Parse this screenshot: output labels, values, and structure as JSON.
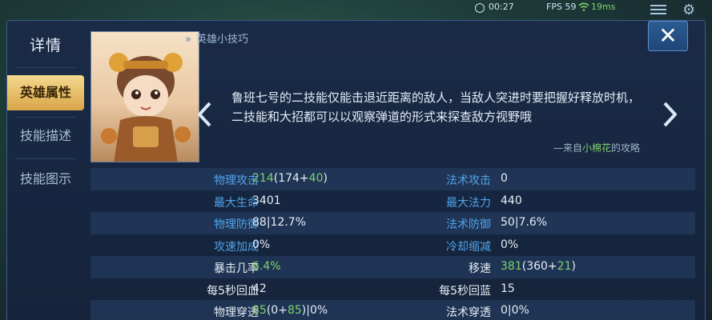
{
  "statusbar": {
    "time": "00:27",
    "fps": "FPS 59",
    "wifi_icon": "wifi-icon",
    "ping": "19ms"
  },
  "sidebar": {
    "title": "详情",
    "items": [
      {
        "label": "英雄属性",
        "active": true
      },
      {
        "label": "技能描述",
        "active": false
      },
      {
        "label": "技能图示",
        "active": false
      }
    ]
  },
  "close_icon": "close-icon",
  "tip": {
    "header": "英雄小技巧",
    "text": "鲁班七号的二技能仅能击退近距离的敌人，当敌人突进时要把握好释放时机，二技能和大招都可以以观察弹道的形式来探查敌方视野哦",
    "source_prefix": "—来自",
    "source_author": "小棉花",
    "source_suffix": "的攻略"
  },
  "stats": [
    {
      "left": {
        "label": "物理攻击",
        "value": "214",
        "value_green": true,
        "extra_open": "(174+",
        "extra_bonus": "40",
        "extra_close": ")"
      },
      "right": {
        "label": "法术攻击",
        "value": "0"
      }
    },
    {
      "left": {
        "label": "最大生命",
        "value": "3401"
      },
      "right": {
        "label": "最大法力",
        "value": "440"
      }
    },
    {
      "left": {
        "label": "物理防御",
        "value": "88|12.7%"
      },
      "right": {
        "label": "法术防御",
        "value": "50|7.6%"
      }
    },
    {
      "left": {
        "label": "攻速加成",
        "value": "0%"
      },
      "right": {
        "label": "冷却缩减",
        "value": "0%"
      }
    },
    {
      "left": {
        "label": "暴击几率",
        "value": "6.4%"
      },
      "right": {
        "label": "移速",
        "value": "381",
        "extra_open": "(360+",
        "extra_bonus": "21",
        "extra_close": ")"
      }
    },
    {
      "left": {
        "label": "每5秒回血",
        "value": "42"
      },
      "right": {
        "label": "每5秒回蓝",
        "value": "15"
      }
    },
    {
      "left": {
        "label": "物理穿透",
        "value": "85",
        "extra_open": "(0+",
        "extra_bonus": "85",
        "extra_close": ")|0%"
      },
      "right": {
        "label": "法术穿透",
        "value": "0|0%"
      }
    }
  ],
  "colors": {
    "label_blue": "#4fa3e8",
    "bonus_green": "#7fd36a",
    "active_gold": "#f4d88e",
    "panel_bg": "#1a2b47"
  }
}
